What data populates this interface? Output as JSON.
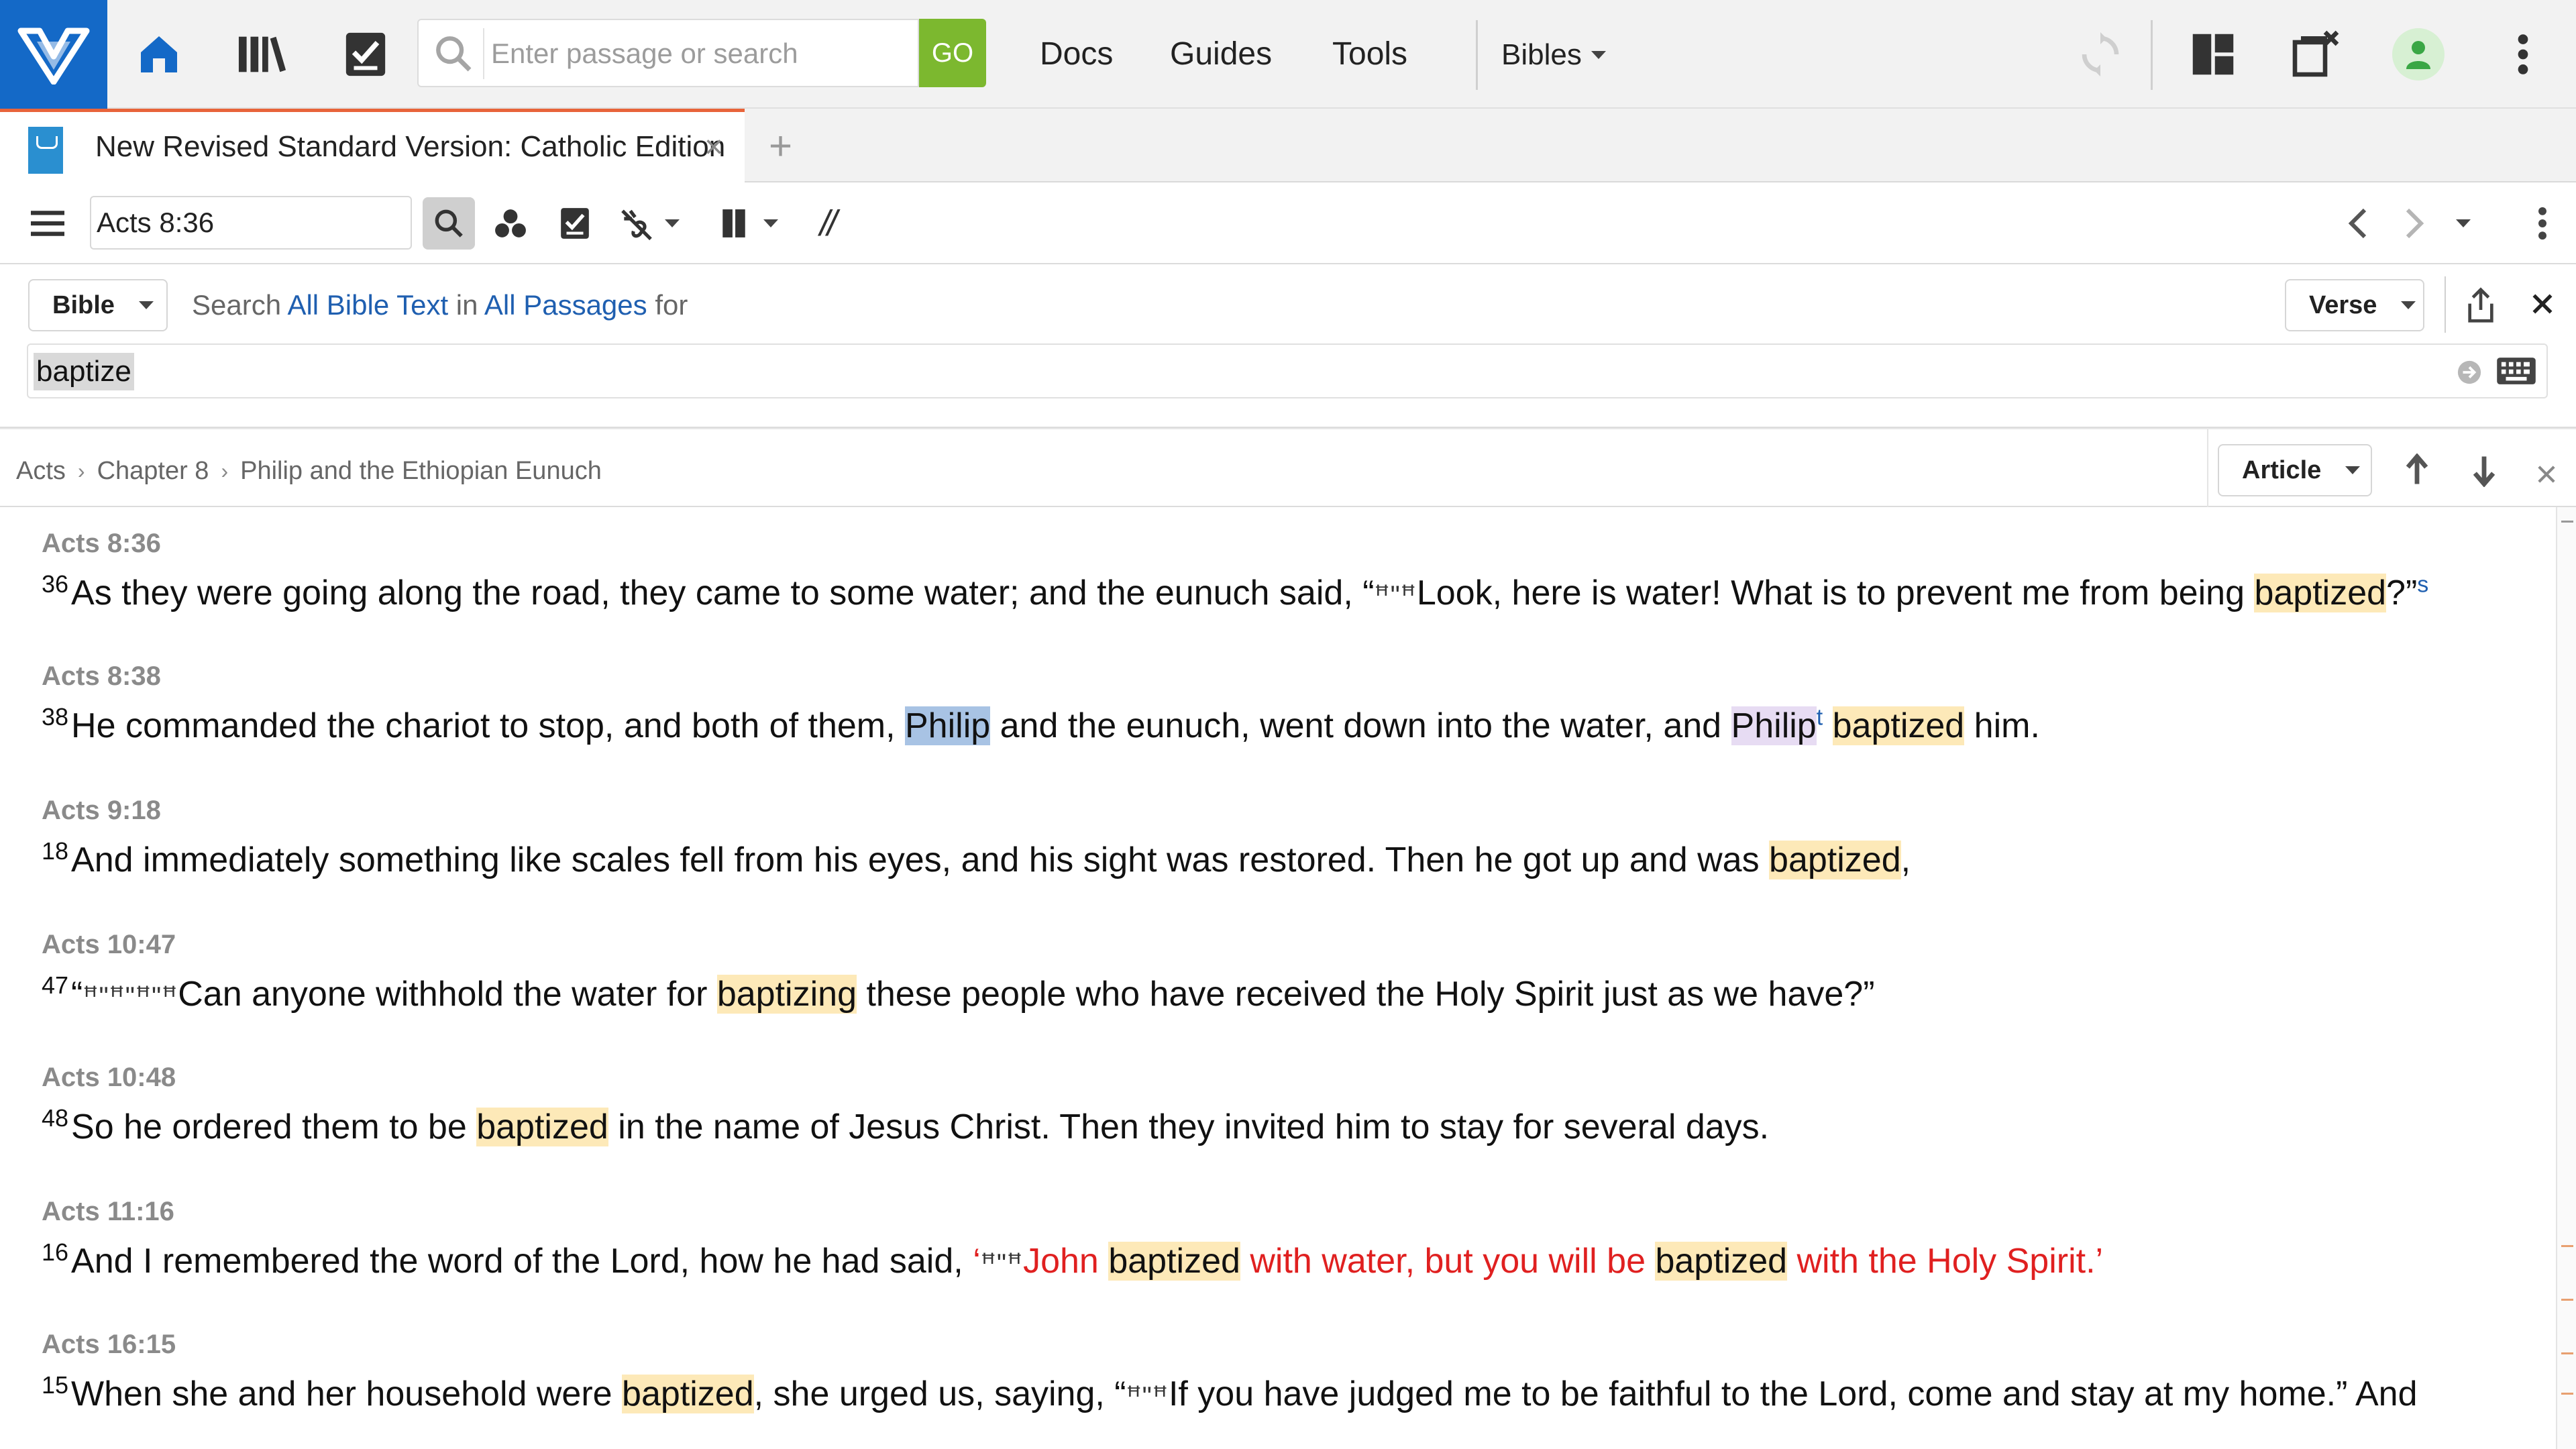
{
  "app": {
    "search_placeholder": "Enter passage or search",
    "go_label": "GO",
    "nav": [
      "Docs",
      "Guides",
      "Tools"
    ],
    "bibles_label": "Bibles"
  },
  "tab": {
    "title": "New Revised Standard Version: Catholic Edition",
    "close": "×",
    "add": "+"
  },
  "toolbar": {
    "reference": "Acts 8:36",
    "parallel_symbol": "//"
  },
  "search": {
    "type": "Bible",
    "prefix": "Search",
    "scope": "All Bible Text",
    "in_word": "in",
    "range": "All Passages",
    "for_word": "for",
    "query": "baptize",
    "view": "Verse"
  },
  "breadcrumb": {
    "items": [
      "Acts",
      "Chapter 8",
      "Philip and the Ethiopian Eunuch"
    ],
    "view": "Article"
  },
  "results": [
    {
      "ref": "Acts 8:36",
      "num": "36",
      "segments": [
        {
          "t": "As they were going along the road, they came to some water; and the eunuch said, “"
        },
        {
          "t": "ꟸ\"ꟸ",
          "g": true
        },
        {
          "t": "Look, here is water! What is to prevent me from being "
        },
        {
          "t": "baptized",
          "h": "hl"
        },
        {
          "t": "?”"
        },
        {
          "t": "s",
          "fn": true
        }
      ]
    },
    {
      "ref": "Acts 8:38",
      "num": "38",
      "segments": [
        {
          "t": "He commanded the chariot to stop, and both of them, "
        },
        {
          "t": "Philip",
          "h": "hl-blue"
        },
        {
          "t": " and the eunuch, went down into the water, and "
        },
        {
          "t": "Philip",
          "h": "hl-purple"
        },
        {
          "t": "t",
          "fn": true
        },
        {
          "t": " "
        },
        {
          "t": "baptized",
          "h": "hl"
        },
        {
          "t": " him."
        }
      ]
    },
    {
      "ref": "Acts 9:18",
      "num": "18",
      "segments": [
        {
          "t": "And immediately something like scales fell from his eyes, and his sight was restored. Then he got up and was "
        },
        {
          "t": "baptized",
          "h": "hl"
        },
        {
          "t": ","
        }
      ]
    },
    {
      "ref": "Acts 10:47",
      "num": "47",
      "segments": [
        {
          "t": "“"
        },
        {
          "t": "ꟸ\"ꟸ\"ꟸ\"ꟸ",
          "g": true
        },
        {
          "t": "Can anyone withhold the water for "
        },
        {
          "t": "baptizing",
          "h": "hl"
        },
        {
          "t": " these people who have received the Holy Spirit just as we have?”"
        }
      ]
    },
    {
      "ref": "Acts 10:48",
      "num": "48",
      "segments": [
        {
          "t": "So he ordered them to be "
        },
        {
          "t": "baptized",
          "h": "hl"
        },
        {
          "t": " in the name of Jesus Christ. Then they invited him to stay for several days."
        }
      ]
    },
    {
      "ref": "Acts 11:16",
      "num": "16",
      "segments": [
        {
          "t": "And I remembered the word of the Lord, how he had said, "
        },
        {
          "t": "‘",
          "red": true
        },
        {
          "t": "ꟸ\"ꟸ",
          "g": true
        },
        {
          "t": "John ",
          "red": true
        },
        {
          "t": "baptized",
          "h": "hl"
        },
        {
          "t": " with water, but you will be ",
          "red": true
        },
        {
          "t": "baptized",
          "h": "hl"
        },
        {
          "t": " with the Holy Spirit.’",
          "red": true
        }
      ]
    },
    {
      "ref": "Acts 16:15",
      "num": "15",
      "segments": [
        {
          "t": "When she and her household were "
        },
        {
          "t": "baptized",
          "h": "hl"
        },
        {
          "t": ", she urged us, saying, “"
        },
        {
          "t": "ꟸ\"ꟸ",
          "g": true
        },
        {
          "t": "If you have judged me to be faithful to the Lord, come and stay at my home.” And"
        }
      ]
    }
  ],
  "colors": {
    "brand": "#1469c7",
    "go": "#7cb82f",
    "tab_accent": "#e8643a",
    "highlight": "#fde9b8",
    "link": "#1f5fb0",
    "words_of_christ": "#e02020"
  }
}
